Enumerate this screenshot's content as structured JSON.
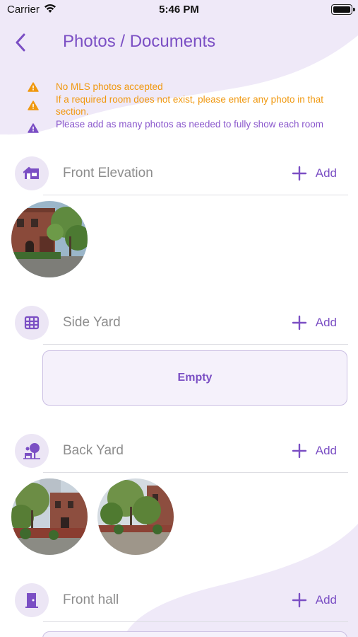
{
  "status_bar": {
    "carrier": "Carrier",
    "time": "5:46 PM",
    "battery_level": 1.0
  },
  "header": {
    "title": "Photos / Documents",
    "back_icon": "chevron-left-icon"
  },
  "notes": [
    {
      "text": "No MLS photos accepted",
      "color": "#f0980f",
      "icon": "warning-icon"
    },
    {
      "text": "If a required room does not exist, please enter any photo in that section.",
      "color": "#f0980f",
      "icon": "warning-icon"
    },
    {
      "text": "Please add as many photos as needed to fully show each room",
      "color": "#8a57cc",
      "icon": "warning-icon"
    }
  ],
  "add_label": "Add",
  "sections": [
    {
      "title": "Front Elevation",
      "icon": "house-icon",
      "photo_count": 1
    },
    {
      "title": "Side Yard",
      "icon": "fence-icon",
      "empty_label": "Empty"
    },
    {
      "title": "Back Yard",
      "icon": "tree-bench-icon",
      "photo_count": 2
    },
    {
      "title": "Front hall",
      "icon": "door-icon"
    }
  ],
  "colors": {
    "accent": "#7b4fc4",
    "warning": "#f0980f",
    "icon_bg": "#ece6f5",
    "blob": "#efe9f8"
  }
}
